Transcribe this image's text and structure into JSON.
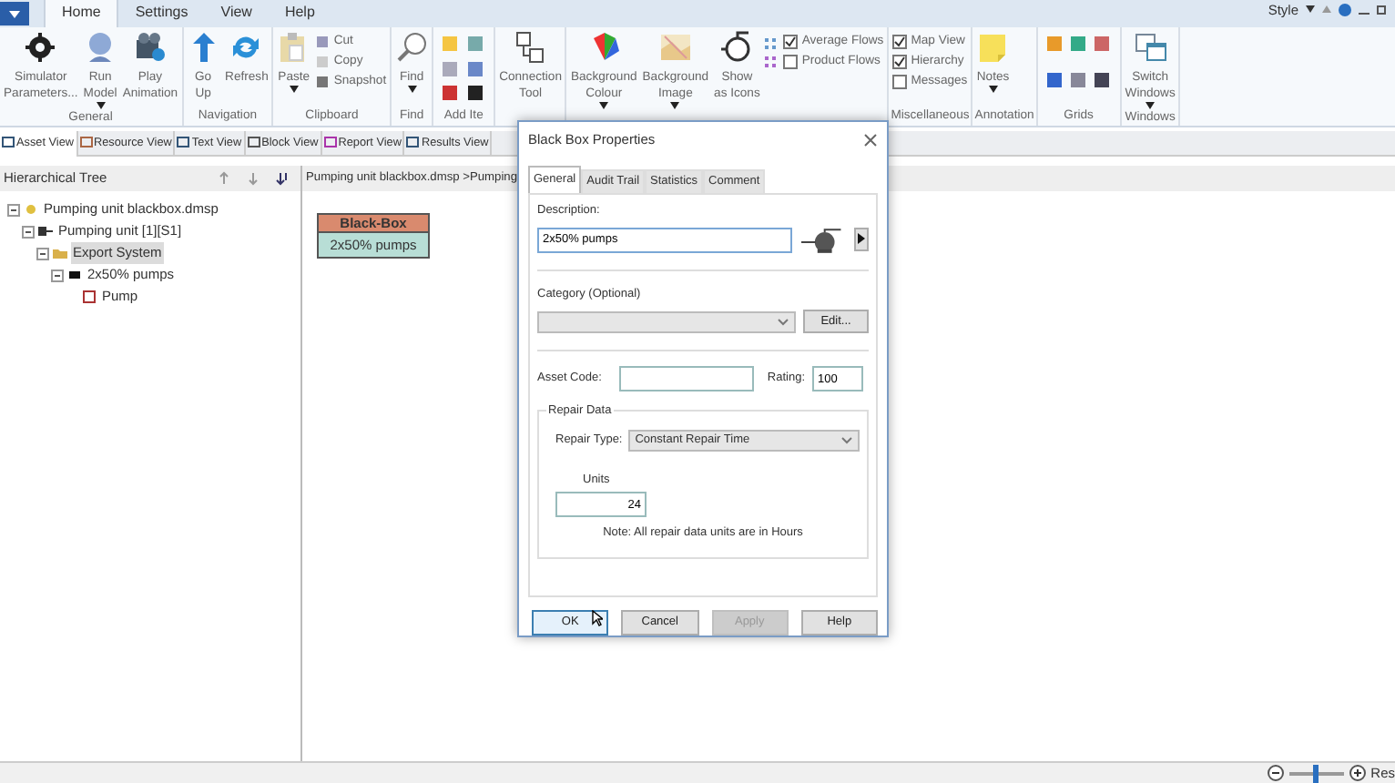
{
  "app_tabs": [
    {
      "label": "Home",
      "selected": true
    },
    {
      "label": "Settings",
      "selected": false
    },
    {
      "label": "View",
      "selected": false
    },
    {
      "label": "Help",
      "selected": false
    }
  ],
  "title_bar": {
    "style_label": "Style"
  },
  "ribbon": [
    {
      "kind": "buttons",
      "label": "General",
      "items": [
        {
          "kind": "large",
          "lines": [
            "Simulator",
            "Parameters..."
          ],
          "dropdown": false
        },
        {
          "kind": "large",
          "lines": [
            "Run",
            "Model"
          ],
          "dropdown": true
        },
        {
          "kind": "large",
          "lines": [
            "Play",
            "Animation"
          ],
          "dropdown": false
        }
      ]
    },
    {
      "kind": "buttons",
      "label": "Navigation",
      "items": [
        {
          "kind": "large",
          "lines": [
            "Go",
            "Up"
          ],
          "dropdown": false
        },
        {
          "kind": "large",
          "lines": [
            "Refresh"
          ],
          "dropdown": false
        }
      ]
    },
    {
      "kind": "buttons",
      "label": "Clipboard",
      "items": [
        {
          "kind": "large",
          "lines": [
            "Paste"
          ],
          "dropdown": true
        },
        {
          "kind": "small",
          "label": "Cut"
        },
        {
          "kind": "small",
          "label": "Copy"
        },
        {
          "kind": "small",
          "label": "Snapshot"
        }
      ]
    },
    {
      "kind": "buttons",
      "label": "Find",
      "items": [
        {
          "kind": "large",
          "lines": [
            "Find"
          ],
          "dropdown": true
        }
      ]
    },
    {
      "kind": "icon_grid",
      "label": "Add Ite"
    },
    {
      "kind": "buttons",
      "items": [
        {
          "kind": "large",
          "lines": [
            "Connection",
            "Tool"
          ],
          "dropdown": false
        }
      ]
    },
    {
      "kind": "buttons",
      "items": [
        {
          "kind": "large",
          "lines": [
            "Background",
            "Colour"
          ],
          "dropdown": true
        },
        {
          "kind": "large",
          "lines": [
            "Background",
            "Image"
          ],
          "dropdown": true
        },
        {
          "kind": "large",
          "lines": [
            "Show",
            "as Icons"
          ],
          "dropdown": false
        },
        {
          "kind": "icons"
        },
        {
          "kind": "check",
          "label": "Average Flows",
          "checked": true
        },
        {
          "kind": "check",
          "label": "Product Flows",
          "checked": false
        }
      ]
    },
    {
      "kind": "buttons",
      "label": "Miscellaneous",
      "items": [
        {
          "kind": "check",
          "label": "Map View",
          "checked": true
        },
        {
          "kind": "check",
          "label": "Hierarchy",
          "checked": true
        },
        {
          "kind": "check",
          "label": "Messages",
          "checked": false
        }
      ]
    },
    {
      "kind": "buttons",
      "label": "Annotation",
      "items": [
        {
          "kind": "large",
          "lines": [
            "Notes"
          ],
          "dropdown": true
        }
      ]
    },
    {
      "kind": "icon_grid",
      "label": "Grids"
    },
    {
      "kind": "buttons",
      "label": "Windows",
      "items": [
        {
          "kind": "large",
          "lines": [
            "Switch",
            "Windows"
          ],
          "dropdown": true
        }
      ]
    }
  ],
  "view_tabs": [
    {
      "label": "Asset View",
      "selected": true
    },
    {
      "label": "Resource View",
      "selected": false
    },
    {
      "label": "Text View",
      "selected": false
    },
    {
      "label": "Block View",
      "selected": false
    },
    {
      "label": "Report View",
      "selected": false
    },
    {
      "label": "Results View",
      "selected": false
    }
  ],
  "tree_panel": {
    "title": "Hierarchical Tree",
    "tree": [
      {
        "label": "Pumping unit blackbox.dmsp",
        "selected": false,
        "expanded": true,
        "children": [
          {
            "label": "Pumping unit [1][S1]",
            "selected": false,
            "expanded": true,
            "children": [
              {
                "label": "Export System",
                "selected": true,
                "expanded": true,
                "children": [
                  {
                    "label": "2x50% pumps",
                    "selected": false,
                    "expanded": true,
                    "children": [
                      {
                        "label": "Pump",
                        "selected": false
                      }
                    ]
                  }
                ]
              }
            ]
          }
        ]
      }
    ]
  },
  "canvas": {
    "breadcrumb": "Pumping unit blackbox.dmsp >Pumping",
    "block": {
      "title": "Black-Box",
      "label": "2x50% pumps"
    }
  },
  "dialog": {
    "title": "Black Box Properties",
    "tabs": [
      {
        "label": "General",
        "selected": true
      },
      {
        "label": "Audit Trail",
        "selected": false
      },
      {
        "label": "Statistics",
        "selected": false
      },
      {
        "label": "Comment",
        "selected": false
      }
    ],
    "description": {
      "label": "Description:",
      "value": "2x50% pumps"
    },
    "category": {
      "label": "Category (Optional)",
      "edit_button": "Edit..."
    },
    "asset_code": {
      "label": "Asset Code:"
    },
    "rating": {
      "label": "Rating:",
      "value": "100"
    },
    "repair_data": {
      "title": "Repair Data",
      "repair_type_label": "Repair Type:",
      "repair_type": "Constant Repair Time",
      "units_label": "Units",
      "units": "24",
      "note": "Note: All repair data units are in Hours"
    },
    "buttons": [
      {
        "label": "OK",
        "kind": "default"
      },
      {
        "label": "Cancel",
        "kind": "normal"
      },
      {
        "label": "Apply",
        "kind": "disabled"
      },
      {
        "label": "Help",
        "kind": "normal"
      }
    ]
  },
  "status_bar": {
    "zoom": {
      "level": 0.5
    },
    "cut_label": "Res"
  }
}
